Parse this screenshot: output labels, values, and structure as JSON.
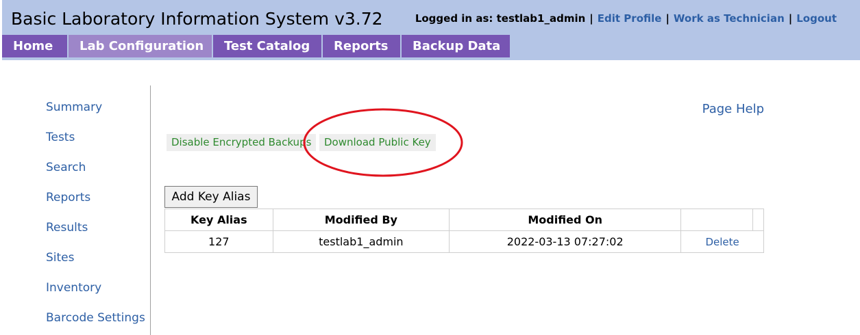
{
  "header": {
    "title": "Basic Laboratory Information System v3.72",
    "logged_in_text": "Logged in as: testlab1_admin",
    "links": {
      "edit_profile": "Edit Profile",
      "work_as_technician": "Work as Technician",
      "logout": "Logout"
    },
    "separator": "|"
  },
  "nav": {
    "tabs": [
      {
        "label": "Home"
      },
      {
        "label": "Lab Configuration",
        "active": true
      },
      {
        "label": "Test Catalog"
      },
      {
        "label": "Reports"
      },
      {
        "label": "Backup Data"
      }
    ]
  },
  "sidebar": {
    "items": [
      {
        "label": "Summary"
      },
      {
        "label": "Tests"
      },
      {
        "label": "Search"
      },
      {
        "label": "Reports"
      },
      {
        "label": "Results"
      },
      {
        "label": "Sites"
      },
      {
        "label": "Inventory"
      },
      {
        "label": "Barcode Settings"
      }
    ]
  },
  "main": {
    "page_help": "Page Help",
    "disable_encrypted_backups": "Disable Encrypted Backups",
    "download_public_key": "Download Public Key",
    "add_key_alias": "Add Key Alias",
    "table": {
      "headers": [
        "Key Alias",
        "Modified By",
        "Modified On",
        ""
      ],
      "rows": [
        {
          "key_alias": "127",
          "modified_by": "testlab1_admin",
          "modified_on": "2022-03-13 07:27:02",
          "action": "Delete"
        }
      ]
    }
  },
  "colors": {
    "header_bg": "#b4c5e6",
    "nav_tab_bg": "#7755b3",
    "nav_tab_active_bg": "#9d86c9",
    "link": "#2d5fa5",
    "green_action": "#2f8a2f",
    "annotation_red": "#e0141e"
  }
}
